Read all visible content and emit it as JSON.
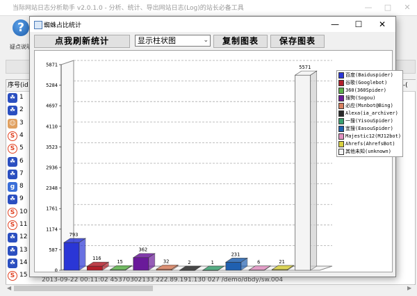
{
  "app": {
    "title": "当际网站日志分析助手 v2.0.1.0 - 分析、统计、导出网站日志(Log)的站长必备工具",
    "toolbar": {
      "help_label": "疑点说明"
    },
    "table": {
      "col_id": "序号(id",
      "col_url": "url-(",
      "row_numbers": [
        "1",
        "2",
        "3",
        "4",
        "5",
        "6",
        "7",
        "8",
        "9",
        "10",
        "11",
        "12",
        "13",
        "14",
        "15"
      ],
      "row_icons": [
        "paw-icon",
        "paw-icon",
        "person-icon",
        "sogou-icon",
        "sogou-icon",
        "paw-icon",
        "paw-icon",
        "google-icon",
        "paw-icon",
        "sogou-icon",
        "sogou-icon",
        "paw-icon",
        "paw-icon",
        "paw-icon",
        "sogou-icon"
      ],
      "bottom_row_text": "2013-09-22 00:11:02    45370302133        222.89.191.130 027           /demo/dbdy/sw.004"
    }
  },
  "dialog": {
    "title": "蜘蛛占比统计",
    "refresh_button": "点我刷新统计",
    "chart_type_selected": "显示柱状图",
    "copy_button": "复制图表",
    "save_button": "保存图表"
  },
  "colors": {
    "accent": "#1e6fd8",
    "dialog_border": "#7a7a7a"
  },
  "chart_data": {
    "type": "bar",
    "title": "",
    "xlabel": "",
    "ylabel": "",
    "ylim": [
      0,
      5871
    ],
    "yticks": [
      0,
      587,
      1174,
      1761,
      2348,
      2936,
      3523,
      4110,
      4697,
      5284,
      5871
    ],
    "grid": true,
    "legend_position": "right",
    "series": [
      {
        "name": "百度(Baiduspider)",
        "value": 793,
        "color": "#2a36d6"
      },
      {
        "name": "谷歌(Googlebot)",
        "value": 116,
        "color": "#b21f2b"
      },
      {
        "name": "360(360Spider)",
        "value": 15,
        "color": "#5cb04a"
      },
      {
        "name": "搜狗(Sogou)",
        "value": 362,
        "color": "#6a1a9a"
      },
      {
        "name": "必应(Msnbot@Bing)",
        "value": 32,
        "color": "#d88060"
      },
      {
        "name": "Alexa(ia_archiver)",
        "value": 2,
        "color": "#2a2a2a"
      },
      {
        "name": "一搜(YisouSpider)",
        "value": 1,
        "color": "#3aa070"
      },
      {
        "name": "宜搜(EasouSpider)",
        "value": 231,
        "color": "#2060b0"
      },
      {
        "name": "Majestic12(MJ12bot)",
        "value": 6,
        "color": "#e090c0"
      },
      {
        "name": "Ahrefs(AhrefsBot)",
        "value": 21,
        "color": "#d8d040"
      },
      {
        "name": "其他未知(unknown)",
        "value": 5571,
        "color": "#f4f4f4"
      }
    ]
  }
}
